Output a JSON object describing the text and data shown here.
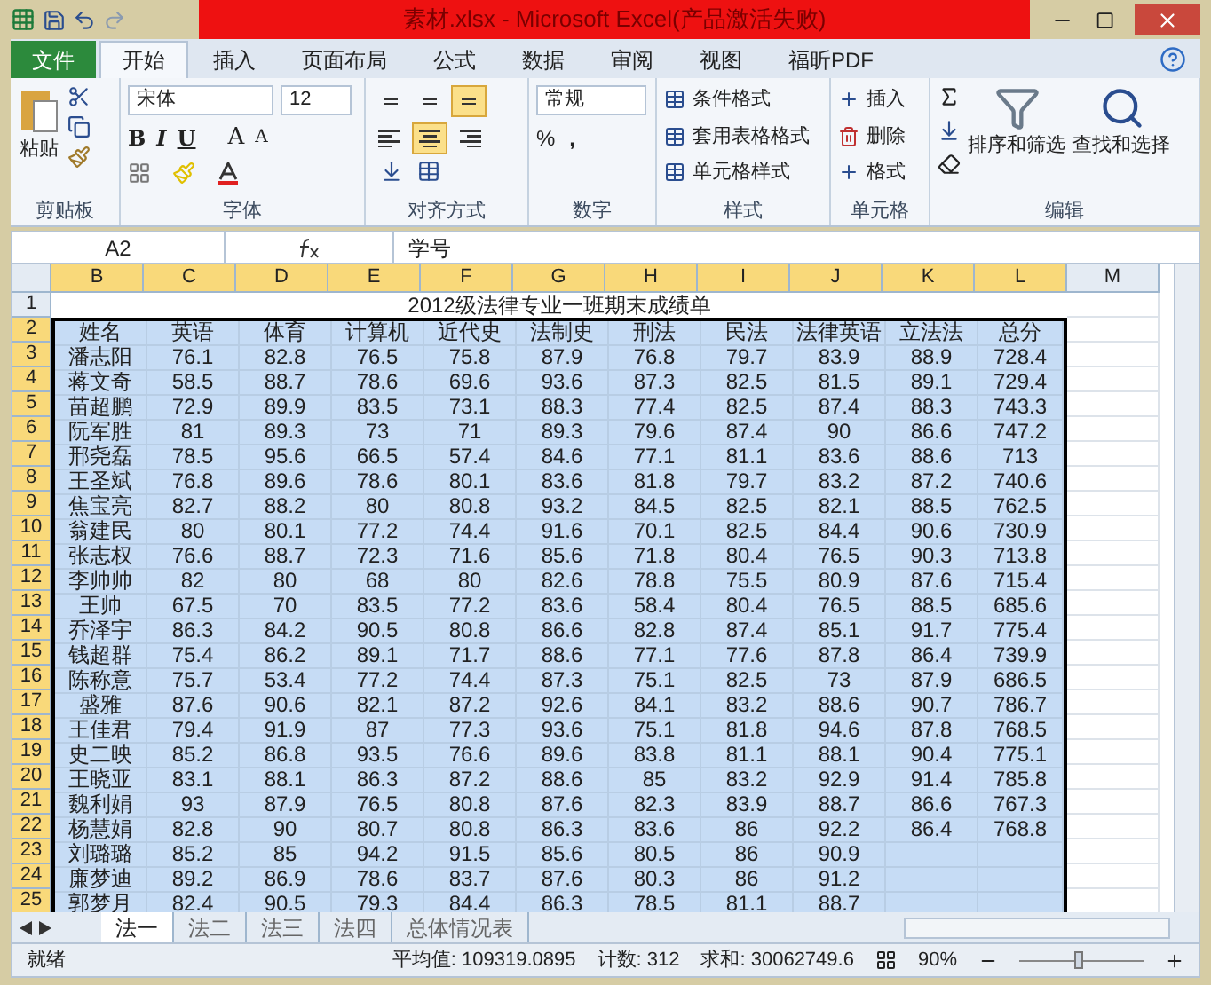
{
  "title_bar": {
    "title": "素材.xlsx - Microsoft Excel(产品激活失败)"
  },
  "file_tab": {
    "label": "文件"
  },
  "ribbon_tabs": [
    {
      "label": "开始",
      "selected": true
    },
    {
      "label": "插入",
      "selected": false
    },
    {
      "label": "页面布局",
      "selected": false
    },
    {
      "label": "公式",
      "selected": false
    },
    {
      "label": "数据",
      "selected": false
    },
    {
      "label": "审阅",
      "selected": false
    },
    {
      "label": "视图",
      "selected": false
    },
    {
      "label": "福昕PDF",
      "selected": false
    }
  ],
  "clipboard": {
    "paste": "粘贴",
    "group": "剪贴板"
  },
  "font": {
    "name": "宋体",
    "size": "12",
    "buttons": [
      "B",
      "I",
      "U"
    ],
    "grow": "A",
    "shrink": "A",
    "group": "字体"
  },
  "alignment": {
    "vertical": [
      {
        "selected": false
      },
      {
        "selected": false
      },
      {
        "selected": true
      }
    ],
    "horizontal": [
      {
        "selected": false
      },
      {
        "selected": true
      },
      {
        "selected": false
      }
    ],
    "group": "对齐方式"
  },
  "number": {
    "format": "常规",
    "percent": "%",
    "comma": ",",
    "group": "数字"
  },
  "styles": {
    "items": [
      "条件格式",
      "套用表格格式",
      "单元格样式"
    ],
    "group": "样式"
  },
  "cells": {
    "items": [
      "插入",
      "删除",
      "格式"
    ],
    "group": "单元格"
  },
  "editing": {
    "sort": "排序和筛选",
    "find": "查找和选择",
    "group": "编辑"
  },
  "formula_bar": {
    "name_box": "A2",
    "content": "学号"
  },
  "columns": [
    {
      "letter": "B",
      "selected": true
    },
    {
      "letter": "C",
      "selected": true
    },
    {
      "letter": "D",
      "selected": true
    },
    {
      "letter": "E",
      "selected": true
    },
    {
      "letter": "F",
      "selected": true
    },
    {
      "letter": "G",
      "selected": true
    },
    {
      "letter": "H",
      "selected": true
    },
    {
      "letter": "I",
      "selected": true
    },
    {
      "letter": "J",
      "selected": true
    },
    {
      "letter": "K",
      "selected": true
    },
    {
      "letter": "L",
      "selected": true
    },
    {
      "letter": "M",
      "selected": false
    }
  ],
  "title_row": {
    "number": "1",
    "text": "2012级法律专业一班期末成绩单",
    "selected": false
  },
  "rows": [
    {
      "number": "2",
      "selected": true,
      "cells": [
        "姓名",
        "英语",
        "体育",
        "计算机",
        "近代史",
        "法制史",
        "刑法",
        "民法",
        "法律英语",
        "立法法",
        "总分"
      ]
    },
    {
      "number": "3",
      "selected": true,
      "cells": [
        "潘志阳",
        "76.1",
        "82.8",
        "76.5",
        "75.8",
        "87.9",
        "76.8",
        "79.7",
        "83.9",
        "88.9",
        "728.4"
      ]
    },
    {
      "number": "4",
      "selected": true,
      "cells": [
        "蒋文奇",
        "58.5",
        "88.7",
        "78.6",
        "69.6",
        "93.6",
        "87.3",
        "82.5",
        "81.5",
        "89.1",
        "729.4"
      ]
    },
    {
      "number": "5",
      "selected": true,
      "cells": [
        "苗超鹏",
        "72.9",
        "89.9",
        "83.5",
        "73.1",
        "88.3",
        "77.4",
        "82.5",
        "87.4",
        "88.3",
        "743.3"
      ]
    },
    {
      "number": "6",
      "selected": true,
      "cells": [
        "阮军胜",
        "81",
        "89.3",
        "73",
        "71",
        "89.3",
        "79.6",
        "87.4",
        "90",
        "86.6",
        "747.2"
      ]
    },
    {
      "number": "7",
      "selected": true,
      "cells": [
        "邢尧磊",
        "78.5",
        "95.6",
        "66.5",
        "57.4",
        "84.6",
        "77.1",
        "81.1",
        "83.6",
        "88.6",
        "713"
      ]
    },
    {
      "number": "8",
      "selected": true,
      "cells": [
        "王圣斌",
        "76.8",
        "89.6",
        "78.6",
        "80.1",
        "83.6",
        "81.8",
        "79.7",
        "83.2",
        "87.2",
        "740.6"
      ]
    },
    {
      "number": "9",
      "selected": true,
      "cells": [
        "焦宝亮",
        "82.7",
        "88.2",
        "80",
        "80.8",
        "93.2",
        "84.5",
        "82.5",
        "82.1",
        "88.5",
        "762.5"
      ]
    },
    {
      "number": "10",
      "selected": true,
      "cells": [
        "翁建民",
        "80",
        "80.1",
        "77.2",
        "74.4",
        "91.6",
        "70.1",
        "82.5",
        "84.4",
        "90.6",
        "730.9"
      ]
    },
    {
      "number": "11",
      "selected": true,
      "cells": [
        "张志权",
        "76.6",
        "88.7",
        "72.3",
        "71.6",
        "85.6",
        "71.8",
        "80.4",
        "76.5",
        "90.3",
        "713.8"
      ]
    },
    {
      "number": "12",
      "selected": true,
      "cells": [
        "李帅帅",
        "82",
        "80",
        "68",
        "80",
        "82.6",
        "78.8",
        "75.5",
        "80.9",
        "87.6",
        "715.4"
      ]
    },
    {
      "number": "13",
      "selected": true,
      "cells": [
        "王帅",
        "67.5",
        "70",
        "83.5",
        "77.2",
        "83.6",
        "58.4",
        "80.4",
        "76.5",
        "88.5",
        "685.6"
      ]
    },
    {
      "number": "14",
      "selected": true,
      "cells": [
        "乔泽宇",
        "86.3",
        "84.2",
        "90.5",
        "80.8",
        "86.6",
        "82.8",
        "87.4",
        "85.1",
        "91.7",
        "775.4"
      ]
    },
    {
      "number": "15",
      "selected": true,
      "cells": [
        "钱超群",
        "75.4",
        "86.2",
        "89.1",
        "71.7",
        "88.6",
        "77.1",
        "77.6",
        "87.8",
        "86.4",
        "739.9"
      ]
    },
    {
      "number": "16",
      "selected": true,
      "cells": [
        "陈称意",
        "75.7",
        "53.4",
        "77.2",
        "74.4",
        "87.3",
        "75.1",
        "82.5",
        "73",
        "87.9",
        "686.5"
      ]
    },
    {
      "number": "17",
      "selected": true,
      "cells": [
        "盛雅",
        "87.6",
        "90.6",
        "82.1",
        "87.2",
        "92.6",
        "84.1",
        "83.2",
        "88.6",
        "90.7",
        "786.7"
      ]
    },
    {
      "number": "18",
      "selected": true,
      "cells": [
        "王佳君",
        "79.4",
        "91.9",
        "87",
        "77.3",
        "93.6",
        "75.1",
        "81.8",
        "94.6",
        "87.8",
        "768.5"
      ]
    },
    {
      "number": "19",
      "selected": true,
      "cells": [
        "史二映",
        "85.2",
        "86.8",
        "93.5",
        "76.6",
        "89.6",
        "83.8",
        "81.1",
        "88.1",
        "90.4",
        "775.1"
      ]
    },
    {
      "number": "20",
      "selected": true,
      "cells": [
        "王晓亚",
        "83.1",
        "88.1",
        "86.3",
        "87.2",
        "88.6",
        "85",
        "83.2",
        "92.9",
        "91.4",
        "785.8"
      ]
    },
    {
      "number": "21",
      "selected": true,
      "cells": [
        "魏利娟",
        "93",
        "87.9",
        "76.5",
        "80.8",
        "87.6",
        "82.3",
        "83.9",
        "88.7",
        "86.6",
        "767.3"
      ]
    },
    {
      "number": "22",
      "selected": true,
      "cells": [
        "杨慧娟",
        "82.8",
        "90",
        "80.7",
        "80.8",
        "86.3",
        "83.6",
        "86",
        "92.2",
        "86.4",
        "768.8"
      ]
    },
    {
      "number": "23",
      "selected": true,
      "cells": [
        "刘璐璐",
        "85.2",
        "85",
        "94.2",
        "91.5",
        "85.6",
        "80.5",
        "86",
        "90.9"
      ]
    },
    {
      "number": "24",
      "selected": true,
      "cells": [
        "廉梦迪",
        "89.2",
        "86.9",
        "78.6",
        "83.7",
        "87.6",
        "80.3",
        "86",
        "91.2"
      ]
    },
    {
      "number": "25",
      "selected": true,
      "cells": [
        "郭梦月",
        "82.4",
        "90.5",
        "79.3",
        "84.4",
        "86.3",
        "78.5",
        "81.1",
        "88.7"
      ]
    }
  ],
  "sheet_tabs": [
    {
      "label": "法一",
      "selected": true
    },
    {
      "label": "法二",
      "selected": false
    },
    {
      "label": "法三",
      "selected": false
    },
    {
      "label": "法四",
      "selected": false
    },
    {
      "label": "总体情况表",
      "selected": false
    }
  ],
  "status_bar": {
    "ready": "就绪",
    "average": "平均值: 109319.0895",
    "count": "计数: 312",
    "sum": "求和: 30062749.6",
    "zoom": "90%",
    "level": 0.47
  }
}
